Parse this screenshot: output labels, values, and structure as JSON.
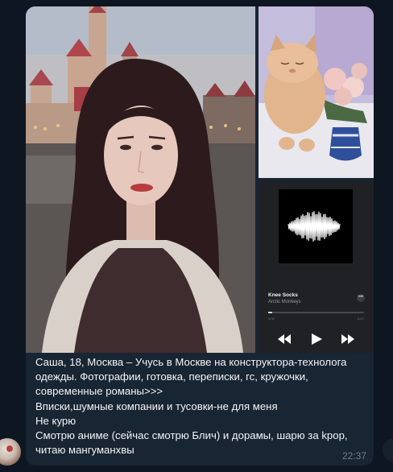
{
  "message": {
    "caption_lines": [
      "Саша, 18, Москва – Учусь в Москве на конструктора-технолога",
      "одежды. Фотографии, готовка, переписки, гс, кружочки,",
      "современные романы>>>",
      "Вписки,шумные компании и тусовки-не для меня",
      "Не курю",
      "Смотрю аниме (сейчас смотрю Блич) и дорамы, шарю за kpop,",
      "читаю мангуманхвы"
    ],
    "time": "22:37"
  },
  "music_card": {
    "track_title": "Knee Socks",
    "artist": "Arctic Monkeys",
    "progress": 0.04,
    "elapsed": "0:00",
    "remaining": "-4:17",
    "icons": [
      "more-icon",
      "rewind-icon",
      "play-icon",
      "fast-forward-icon"
    ]
  },
  "colors": {
    "background": "#0e1621",
    "bubble": "#182533",
    "text": "#f5f5f5",
    "time": "#6d7f8f"
  }
}
